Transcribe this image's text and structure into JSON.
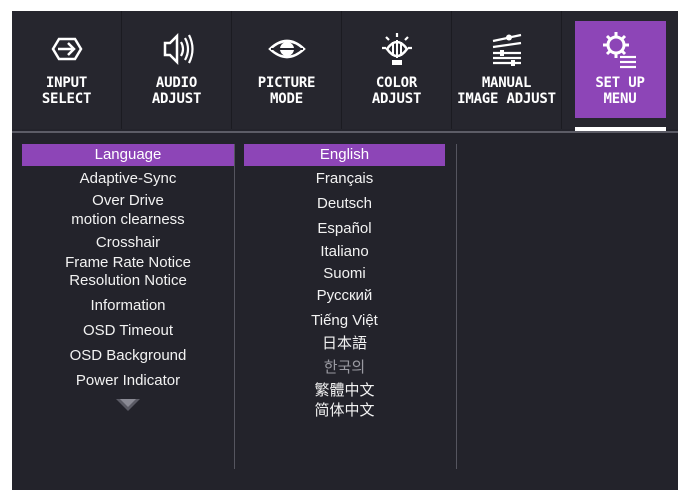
{
  "tabs": [
    {
      "id": "input",
      "label": "INPUT\nSELECT",
      "icon": "input-arrow-icon",
      "active": false
    },
    {
      "id": "audio",
      "label": "AUDIO\nADJUST",
      "icon": "speaker-icon",
      "active": false
    },
    {
      "id": "picture",
      "label": "PICTURE\nMODE",
      "icon": "eye-icon",
      "active": false
    },
    {
      "id": "color",
      "label": "COLOR\nADJUST",
      "icon": "color-bulb-icon",
      "active": false
    },
    {
      "id": "manual",
      "label": "MANUAL\nIMAGE ADJUST",
      "icon": "sliders-icon",
      "active": false
    },
    {
      "id": "setup",
      "label": "SET UP\nMENU",
      "icon": "gear-list-icon",
      "active": true
    }
  ],
  "menu_items": [
    "Language",
    "Adaptive-Sync",
    "Over Drive",
    "motion clearness",
    "Crosshair",
    "Frame Rate Notice",
    "Resolution Notice",
    "Information",
    "OSD Timeout",
    "OSD Background",
    "Power Indicator"
  ],
  "selected_menu_item": "Language",
  "language_options": [
    "English",
    "Français",
    "Deutsch",
    "Español",
    "Italiano",
    "Suomi",
    "Русский",
    "Tiếng Việt",
    "日本語",
    "한국의",
    "繁體中文",
    "简体中文"
  ],
  "selected_language": "English",
  "scroll_indicator_icon": "scroll-down-arrow-icon",
  "colors": {
    "accent": "#8d45b7",
    "background": "#23232b",
    "text": "#f2f2f2"
  }
}
